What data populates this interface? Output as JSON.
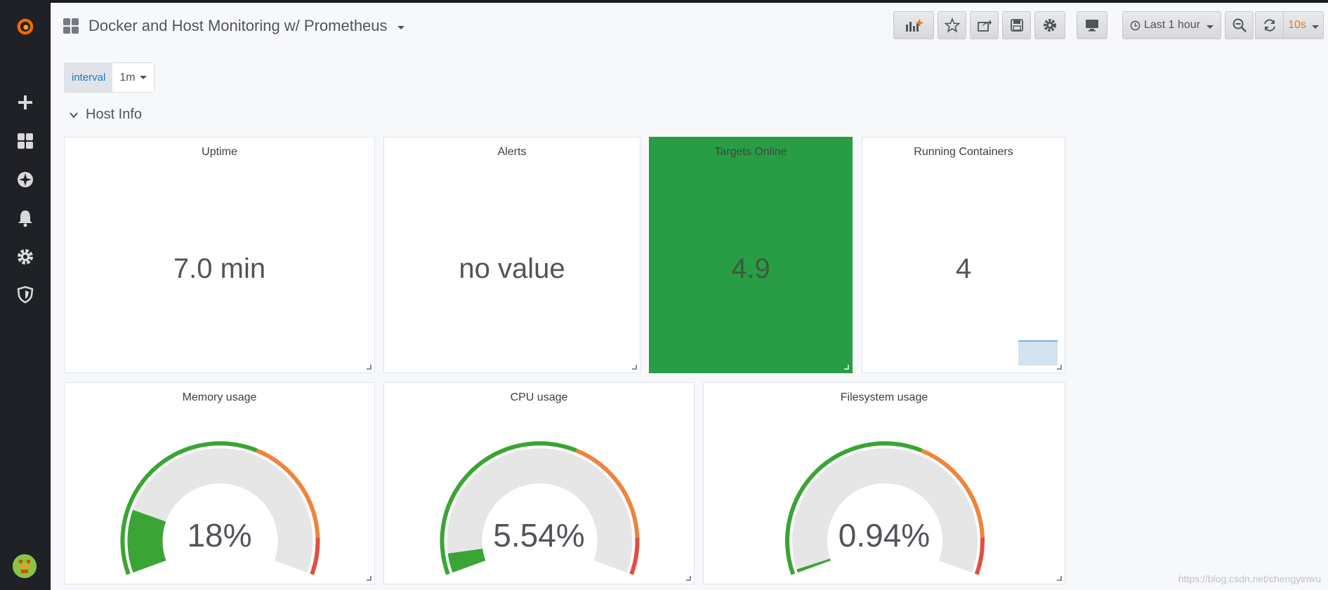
{
  "dashboard": {
    "title": "Docker and Host Monitoring w/ Prometheus"
  },
  "toolbar": {
    "time_range": "Last 1 hour",
    "refresh_interval": "10s",
    "buttons": [
      "add-panel-icon",
      "star-icon",
      "share-icon",
      "save-icon",
      "gear-icon",
      "monitor-icon",
      "zoom-out-icon",
      "refresh-icon"
    ]
  },
  "variables": {
    "interval_label": "interval",
    "interval_value": "1m"
  },
  "row": {
    "title": "Host Info"
  },
  "panels": {
    "uptime": {
      "title": "Uptime",
      "value": "7.0 min"
    },
    "alerts": {
      "title": "Alerts",
      "value": "no value"
    },
    "targets": {
      "title": "Targets Online",
      "value": "4.9"
    },
    "containers": {
      "title": "Running Containers",
      "value": "4"
    },
    "memory": {
      "title": "Memory usage",
      "value": "18%",
      "fraction": 0.18
    },
    "cpu": {
      "title": "CPU usage",
      "value": "5.54%",
      "fraction": 0.0554
    },
    "filesystem": {
      "title": "Filesystem usage",
      "value": "0.94%",
      "fraction": 0.0094
    }
  },
  "colors": {
    "green": "#3aa534",
    "orange": "#ef843c",
    "red": "#e24d42",
    "stat_green": "#299c46"
  },
  "watermark": "https://blog.csdn.net/chengyinwu"
}
